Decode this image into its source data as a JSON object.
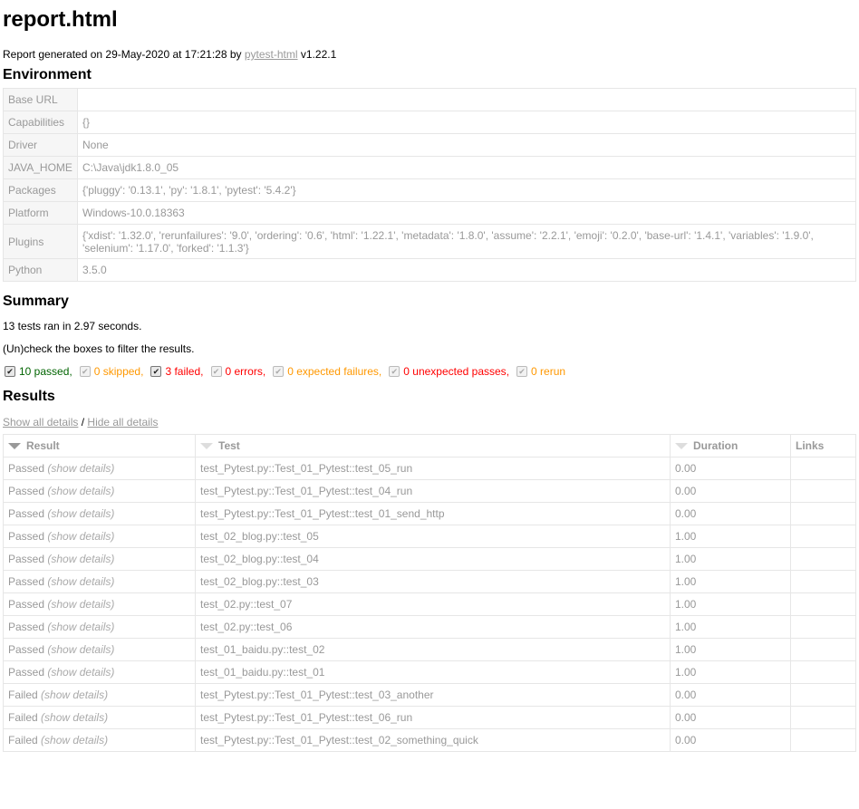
{
  "title": "report.html",
  "generated": {
    "prefix": "Report generated on 29-May-2020 at 17:21:28 by ",
    "link": "pytest-html",
    "suffix": " v1.22.1"
  },
  "environment": {
    "heading": "Environment",
    "rows": [
      {
        "key": "Base URL",
        "value": ""
      },
      {
        "key": "Capabilities",
        "value": "{}"
      },
      {
        "key": "Driver",
        "value": "None"
      },
      {
        "key": "JAVA_HOME",
        "value": "C:\\Java\\jdk1.8.0_05"
      },
      {
        "key": "Packages",
        "value": "{'pluggy': '0.13.1', 'py': '1.8.1', 'pytest': '5.4.2'}"
      },
      {
        "key": "Platform",
        "value": "Windows-10.0.18363"
      },
      {
        "key": "Plugins",
        "value": "{'xdist': '1.32.0', 'rerunfailures': '9.0', 'ordering': '0.6', 'html': '1.22.1', 'metadata': '1.8.0', 'assume': '2.2.1', 'emoji': '0.2.0', 'base-url': '1.4.1', 'variables': '1.9.0', 'selenium': '1.17.0', 'forked': '1.1.3'}"
      },
      {
        "key": "Python",
        "value": "3.5.0"
      }
    ]
  },
  "summary": {
    "heading": "Summary",
    "ran": "13 tests ran in 2.97 seconds.",
    "hint": "(Un)check the boxes to filter the results.",
    "filters": [
      {
        "label": "10 passed",
        "sep": ",",
        "cls": "passed",
        "checked": true,
        "enabled": true
      },
      {
        "label": "0 skipped",
        "sep": ",",
        "cls": "skipped",
        "checked": true,
        "enabled": false
      },
      {
        "label": "3 failed",
        "sep": ",",
        "cls": "failed",
        "checked": true,
        "enabled": true
      },
      {
        "label": "0 errors",
        "sep": ",",
        "cls": "error",
        "checked": true,
        "enabled": false
      },
      {
        "label": "0 expected failures",
        "sep": ",",
        "cls": "xfailed",
        "checked": true,
        "enabled": false
      },
      {
        "label": "0 unexpected passes",
        "sep": ",",
        "cls": "xpassed",
        "checked": true,
        "enabled": false
      },
      {
        "label": "0 rerun",
        "sep": "",
        "cls": "rerun",
        "checked": true,
        "enabled": false
      }
    ]
  },
  "results": {
    "heading": "Results",
    "show_all": "Show all details",
    "divider": "/",
    "hide_all": "Hide all details",
    "columns": {
      "result": "Result",
      "test": "Test",
      "duration": "Duration",
      "links": "Links"
    },
    "show_details": "(show details)",
    "rows": [
      {
        "result": "Passed",
        "test": "test_Pytest.py::Test_01_Pytest::test_05_run",
        "duration": "0.00"
      },
      {
        "result": "Passed",
        "test": "test_Pytest.py::Test_01_Pytest::test_04_run",
        "duration": "0.00"
      },
      {
        "result": "Passed",
        "test": "test_Pytest.py::Test_01_Pytest::test_01_send_http",
        "duration": "0.00"
      },
      {
        "result": "Passed",
        "test": "test_02_blog.py::test_05",
        "duration": "1.00"
      },
      {
        "result": "Passed",
        "test": "test_02_blog.py::test_04",
        "duration": "1.00"
      },
      {
        "result": "Passed",
        "test": "test_02_blog.py::test_03",
        "duration": "1.00"
      },
      {
        "result": "Passed",
        "test": "test_02.py::test_07",
        "duration": "1.00"
      },
      {
        "result": "Passed",
        "test": "test_02.py::test_06",
        "duration": "1.00"
      },
      {
        "result": "Passed",
        "test": "test_01_baidu.py::test_02",
        "duration": "1.00"
      },
      {
        "result": "Passed",
        "test": "test_01_baidu.py::test_01",
        "duration": "1.00"
      },
      {
        "result": "Failed",
        "test": "test_Pytest.py::Test_01_Pytest::test_03_another",
        "duration": "0.00"
      },
      {
        "result": "Failed",
        "test": "test_Pytest.py::Test_01_Pytest::test_06_run",
        "duration": "0.00"
      },
      {
        "result": "Failed",
        "test": "test_Pytest.py::Test_01_Pytest::test_02_something_quick",
        "duration": "0.00"
      }
    ]
  }
}
